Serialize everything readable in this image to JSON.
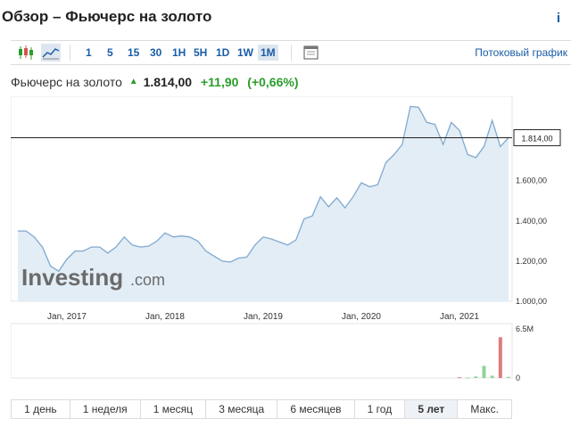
{
  "header": {
    "title": "Обзор – Фьючерс на золото",
    "info_icon": "i"
  },
  "toolbar": {
    "chart_type_icons": [
      "candlestick-icon",
      "area-chart-icon"
    ],
    "timeframes": [
      {
        "label": "1",
        "active": false
      },
      {
        "label": "5",
        "active": false
      },
      {
        "label": "15",
        "active": false
      },
      {
        "label": "30",
        "active": false
      },
      {
        "label": "1H",
        "active": false
      },
      {
        "label": "5H",
        "active": false
      },
      {
        "label": "1D",
        "active": false
      },
      {
        "label": "1W",
        "active": false
      },
      {
        "label": "1M",
        "active": true
      }
    ],
    "settings_icon": "window-icon",
    "stream_link": "Потоковый график"
  },
  "quote": {
    "name": "Фьючерс на золото",
    "price": "1.814,00",
    "change": "+11,90",
    "change_pct": "(+0,66%)",
    "direction": "up"
  },
  "colors": {
    "accent": "#1a5ca6",
    "positive": "#2a9d2a",
    "negative": "#d9534f",
    "line": "#7fa9cf",
    "fill": "#e3edf6"
  },
  "chart_data": {
    "type": "area",
    "x": [
      "2016-07",
      "2016-08",
      "2016-09",
      "2016-10",
      "2016-11",
      "2016-12",
      "2017-01",
      "2017-02",
      "2017-03",
      "2017-04",
      "2017-05",
      "2017-06",
      "2017-07",
      "2017-08",
      "2017-09",
      "2017-10",
      "2017-11",
      "2017-12",
      "2018-01",
      "2018-02",
      "2018-03",
      "2018-04",
      "2018-05",
      "2018-06",
      "2018-07",
      "2018-08",
      "2018-09",
      "2018-10",
      "2018-11",
      "2018-12",
      "2019-01",
      "2019-02",
      "2019-03",
      "2019-04",
      "2019-05",
      "2019-06",
      "2019-07",
      "2019-08",
      "2019-09",
      "2019-10",
      "2019-11",
      "2019-12",
      "2020-01",
      "2020-02",
      "2020-03",
      "2020-04",
      "2020-05",
      "2020-06",
      "2020-07",
      "2020-08",
      "2020-09",
      "2020-10",
      "2020-11",
      "2020-12",
      "2021-01",
      "2021-02",
      "2021-03",
      "2021-04",
      "2021-05",
      "2021-06",
      "2021-07"
    ],
    "y": [
      1350,
      1350,
      1320,
      1270,
      1175,
      1150,
      1210,
      1250,
      1250,
      1270,
      1270,
      1240,
      1270,
      1320,
      1280,
      1270,
      1275,
      1300,
      1340,
      1320,
      1325,
      1320,
      1300,
      1250,
      1225,
      1200,
      1195,
      1215,
      1220,
      1280,
      1320,
      1310,
      1295,
      1280,
      1305,
      1410,
      1425,
      1520,
      1470,
      1515,
      1465,
      1520,
      1590,
      1570,
      1580,
      1690,
      1730,
      1780,
      1970,
      1965,
      1890,
      1880,
      1780,
      1890,
      1850,
      1730,
      1715,
      1770,
      1900,
      1770,
      1814
    ],
    "xlim": [
      "2016-07",
      "2021-07"
    ],
    "ylim": [
      1000,
      2020
    ],
    "yticks": [
      1000,
      1200,
      1400,
      1600
    ],
    "ytick_labels": [
      "1.000,00",
      "1.200,00",
      "1.400,00",
      "1.600,00"
    ],
    "xtick_labels": [
      "Jan, 2017",
      "Jan, 2018",
      "Jan, 2019",
      "Jan, 2020",
      "Jan, 2021"
    ],
    "xtick_dates": [
      "2017-01",
      "2018-01",
      "2019-01",
      "2020-01",
      "2021-01"
    ],
    "current_price": 1814,
    "current_price_label": "1.814,00",
    "watermark": "Investing.com",
    "volume": {
      "x": [
        "2021-01",
        "2021-02",
        "2021-03",
        "2021-04",
        "2021-05",
        "2021-06",
        "2021-07"
      ],
      "values": [
        0.1,
        0.05,
        0.2,
        1.6,
        0.3,
        5.4,
        0.15
      ],
      "direction": [
        "down",
        "up",
        "up",
        "up",
        "up",
        "down",
        "up"
      ],
      "ytick_labels": [
        "6.5M",
        "0"
      ],
      "yticks": [
        6.5,
        0
      ]
    }
  },
  "ranges": [
    {
      "label": "1 день",
      "active": false
    },
    {
      "label": "1 неделя",
      "active": false
    },
    {
      "label": "1 месяц",
      "active": false
    },
    {
      "label": "3 месяца",
      "active": false
    },
    {
      "label": "6 месяцев",
      "active": false
    },
    {
      "label": "1 год",
      "active": false
    },
    {
      "label": "5 лет",
      "active": true
    },
    {
      "label": "Макс.",
      "active": false
    }
  ]
}
